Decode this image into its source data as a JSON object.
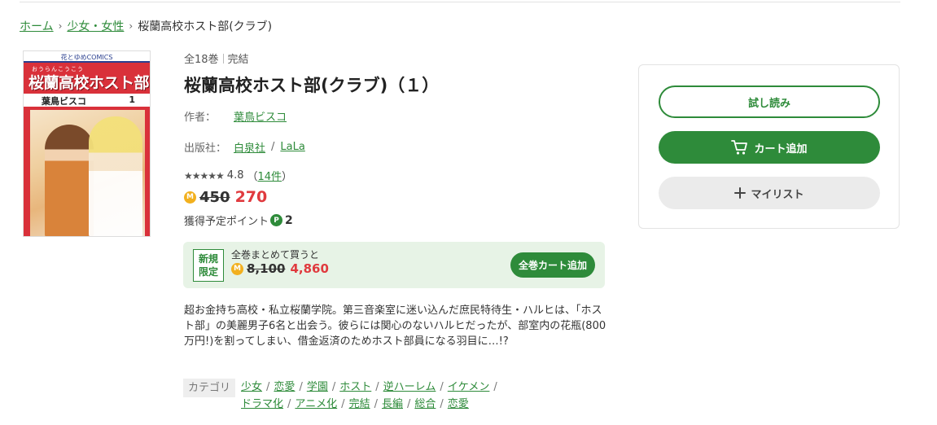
{
  "breadcrumb": {
    "home": "ホーム",
    "category": "少女・女性",
    "current": "桜蘭高校ホスト部(クラブ)"
  },
  "cover": {
    "publisher_label": "花とゆめCOMICS",
    "ruby": "おうらんこうこう",
    "title": "桜蘭高校ホスト部",
    "author": "葉鳥ビスコ",
    "volume": "1"
  },
  "meta": {
    "volumes": "全18巻",
    "status": "完結"
  },
  "title": "桜蘭高校ホスト部(クラブ)（１）",
  "author": {
    "label": "作者：",
    "name": "葉鳥ビスコ"
  },
  "publisher": {
    "label": "出版社：",
    "name": "白泉社",
    "label_name": "LaLa"
  },
  "rating": {
    "stars": "★★★★★",
    "score": "4.8",
    "count_open": "（",
    "count_link": "14件",
    "count_close": "）"
  },
  "price": {
    "coin": "M",
    "original": "450",
    "current": "270"
  },
  "points": {
    "label": "獲得予定ポイント",
    "icon": "P",
    "value": "2"
  },
  "bulk": {
    "tag_line1": "新規",
    "tag_line2": "限定",
    "lead": "全巻まとめて買うと",
    "coin": "M",
    "original": "8,100",
    "current": "4,860",
    "button": "全巻カート追加"
  },
  "description": "超お金持ち高校・私立桜蘭学院。第三音楽室に迷い込んだ庶民特待生・ハルヒは、「ホスト部」の美麗男子6名と出会う。彼らには関心のないハルヒだったが、部室内の花瓶(800万円!)を割ってしまい、借金返済のためホスト部員になる羽目に…!?",
  "category": {
    "label": "カテゴリ",
    "items": [
      "少女",
      "恋愛",
      "学園",
      "ホスト",
      "逆ハーレム",
      "イケメン",
      "ドラマ化",
      "アニメ化",
      "完結",
      "長編",
      "総合",
      "恋愛"
    ]
  },
  "actions": {
    "try_read": "試し読み",
    "add_cart": "カート追加",
    "my_list": "マイリスト"
  },
  "colors": {
    "accent": "#2e8b3a",
    "price_red": "#e03a3e",
    "coin": "#f2b01e",
    "bulk_bg": "#e7f3e6"
  }
}
